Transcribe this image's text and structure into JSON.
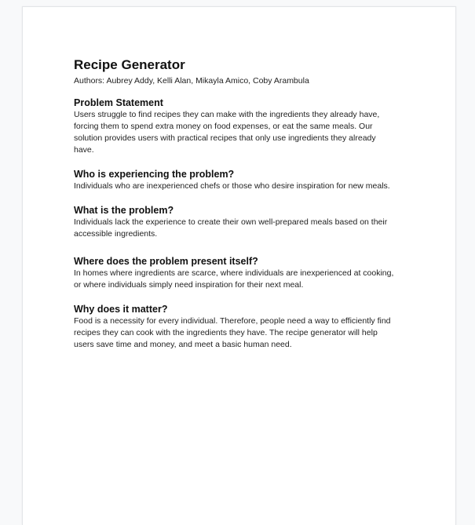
{
  "document": {
    "title": "Recipe Generator",
    "authors": "Authors: Aubrey Addy, Kelli Alan, Mikayla Amico, Coby Arambula",
    "sections": [
      {
        "heading": "Problem Statement",
        "lines": [
          "Users struggle to find recipes they can make with the ingredients they already have,",
          "forcing them to spend extra money on food expenses, or eat the same meals. Our",
          "solution provides users with practical recipes that only use ingredients they already",
          "have."
        ]
      },
      {
        "heading": "Who is experiencing the problem?",
        "lines": [
          "Individuals who are inexperienced chefs or those who desire inspiration for new meals."
        ]
      },
      {
        "heading": "What is the problem?",
        "lines": [
          "Individuals lack the experience to create their own well-prepared meals based on their",
          "accessible ingredients."
        ]
      },
      {
        "heading": "Where does the problem present itself?",
        "lines": [
          "In homes where ingredients are scarce, where individuals are inexperienced at cooking,",
          "or where individuals simply need inspiration for their next meal."
        ]
      },
      {
        "heading": "Why does it matter?",
        "lines": [
          "Food is a necessity for every individual. Therefore, people need a way to efficiently find",
          "recipes they can cook with the ingredients they have. The recipe generator will help",
          "users save time and money, and meet a basic human need."
        ]
      }
    ]
  }
}
